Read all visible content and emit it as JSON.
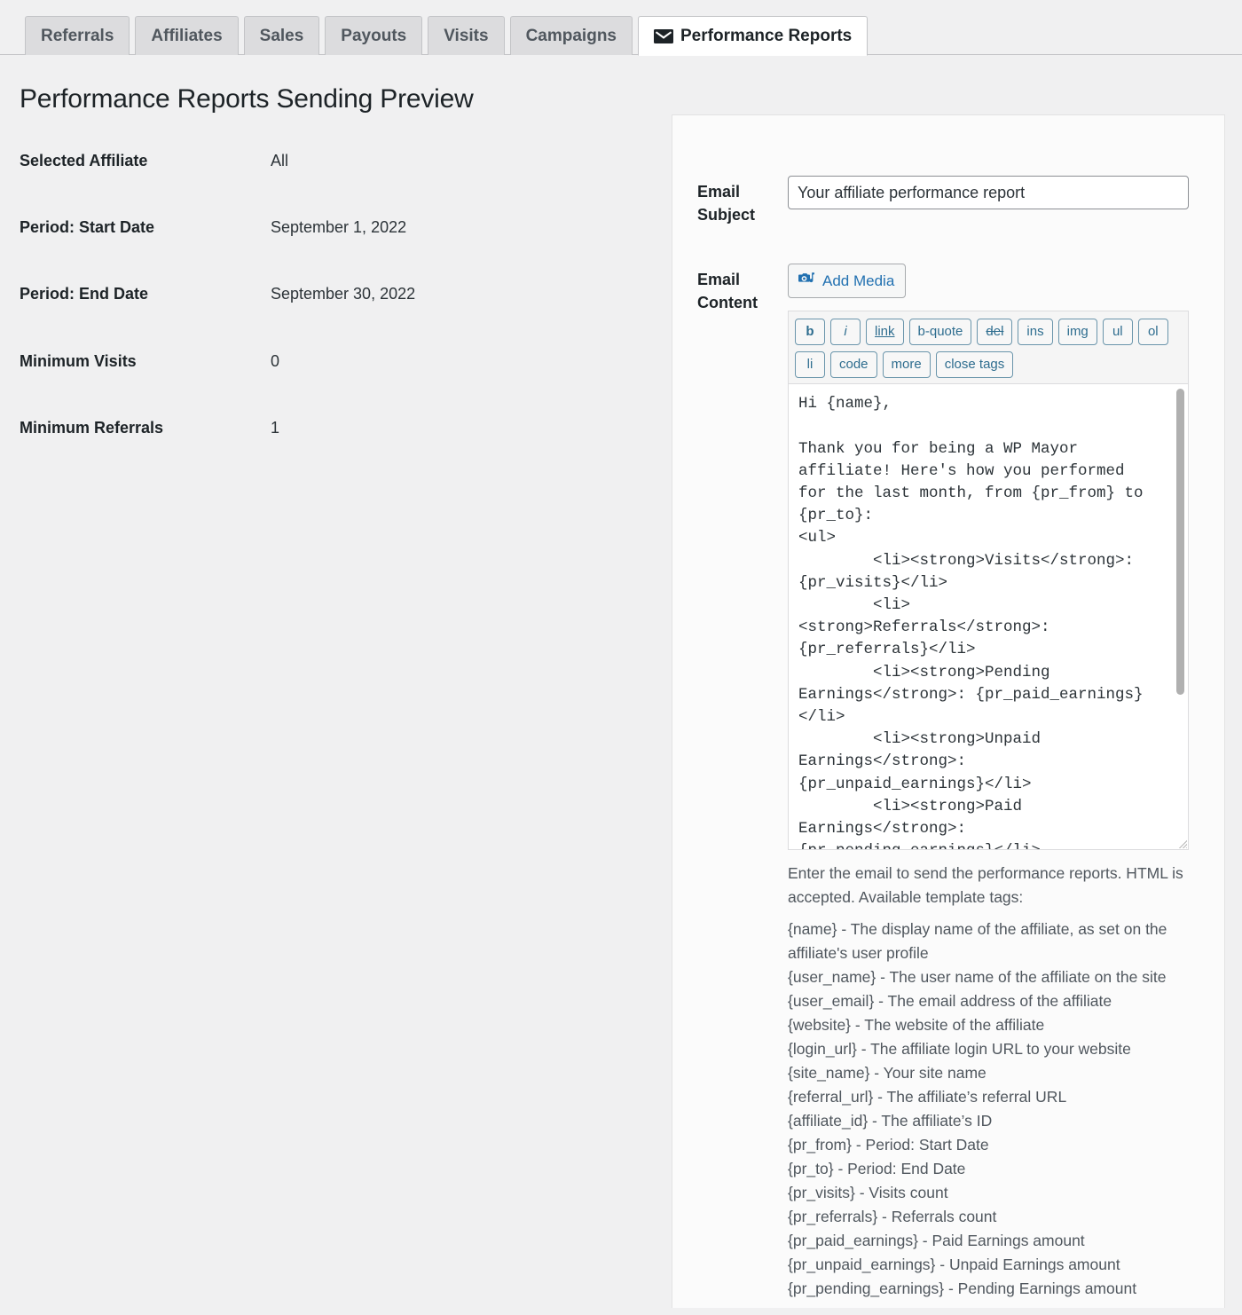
{
  "tabs": [
    {
      "label": "Referrals",
      "active": false,
      "icon": null
    },
    {
      "label": "Affiliates",
      "active": false,
      "icon": null
    },
    {
      "label": "Sales",
      "active": false,
      "icon": null
    },
    {
      "label": "Payouts",
      "active": false,
      "icon": null
    },
    {
      "label": "Visits",
      "active": false,
      "icon": null
    },
    {
      "label": "Campaigns",
      "active": false,
      "icon": null
    },
    {
      "label": "Performance Reports",
      "active": true,
      "icon": "mail-icon"
    }
  ],
  "page_title": "Performance Reports Sending Preview",
  "summary": {
    "rows": [
      {
        "label": "Selected Affiliate",
        "value": "All"
      },
      {
        "label": "Period: Start Date",
        "value": "September 1, 2022"
      },
      {
        "label": "Period: End Date",
        "value": "September 30, 2022"
      },
      {
        "label": "Minimum Visits",
        "value": "0"
      },
      {
        "label": "Minimum Referrals",
        "value": "1"
      }
    ]
  },
  "form": {
    "subject": {
      "label": "Email Subject",
      "value": "Your affiliate performance report",
      "placeholder": ""
    },
    "content": {
      "label": "Email Content",
      "add_media_label": "Add Media",
      "add_media_icon": "media-camera-note-icon",
      "toolbar_buttons": [
        {
          "label": "b",
          "style": "b"
        },
        {
          "label": "i",
          "style": "i"
        },
        {
          "label": "link",
          "style": "u"
        },
        {
          "label": "b-quote",
          "style": ""
        },
        {
          "label": "del",
          "style": "s"
        },
        {
          "label": "ins",
          "style": ""
        },
        {
          "label": "img",
          "style": ""
        },
        {
          "label": "ul",
          "style": ""
        },
        {
          "label": "ol",
          "style": ""
        },
        {
          "label": "li",
          "style": ""
        },
        {
          "label": "code",
          "style": ""
        },
        {
          "label": "more",
          "style": ""
        },
        {
          "label": "close tags",
          "style": ""
        }
      ],
      "value": "Hi {name},\n\nThank you for being a WP Mayor affiliate! Here's how you performed for the last month, from {pr_from} to {pr_to}:\n<ul>\n\t<li><strong>Visits</strong>: {pr_visits}</li>\n\t<li><strong>Referrals</strong>: {pr_referrals}</li>\n\t<li><strong>Pending Earnings</strong>: {pr_paid_earnings}</li>\n\t<li><strong>Unpaid Earnings</strong>: {pr_unpaid_earnings}</li>\n\t<li><strong>Paid Earnings</strong>: {pr_pending_earnings}</li>\n</ul>"
    },
    "help": {
      "intro": "Enter the email to send the performance reports. HTML is accepted. Available template tags:",
      "tags": [
        "{name} - The display name of the affiliate, as set on the affiliate's user profile",
        "{user_name} - The user name of the affiliate on the site",
        "{user_email} - The email address of the affiliate",
        "{website} - The website of the affiliate",
        "{login_url} - The affiliate login URL to your website",
        "{site_name} - Your site name",
        "{referral_url} - The affiliate’s referral URL",
        "{affiliate_id} - The affiliate’s ID",
        "{pr_from} - Period: Start Date",
        "{pr_to} - Period: End Date",
        "{pr_visits} - Visits count",
        "{pr_referrals} - Referrals count",
        "{pr_paid_earnings} - Paid Earnings amount",
        "{pr_unpaid_earnings} - Unpaid Earnings amount",
        "{pr_pending_earnings} - Pending Earnings amount"
      ]
    }
  },
  "colors": {
    "page_bg": "#f0f0f1",
    "tab_bg": "#dcdcde",
    "tab_active_bg": "#ffffff",
    "link_blue": "#2271b1",
    "quicktag_blue": "#2e6d8f",
    "text": "#1d2327",
    "muted_text": "#50575e"
  }
}
